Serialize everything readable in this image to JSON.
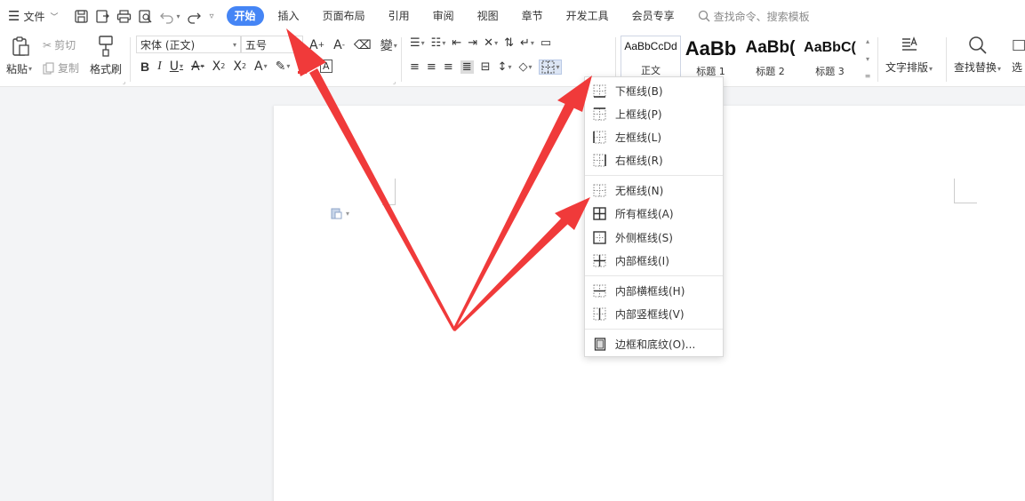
{
  "menu": {
    "file_label": "文件",
    "tabs": [
      {
        "label": "开始",
        "active": true
      },
      {
        "label": "插入"
      },
      {
        "label": "页面布局"
      },
      {
        "label": "引用"
      },
      {
        "label": "审阅"
      },
      {
        "label": "视图"
      },
      {
        "label": "章节"
      },
      {
        "label": "开发工具"
      },
      {
        "label": "会员专享"
      }
    ],
    "search_placeholder": "查找命令、搜索模板"
  },
  "ribbon": {
    "paste_label": "粘贴",
    "cut_label": "剪切",
    "copy_label": "复制",
    "format_painter_label": "格式刷",
    "font_name": "宋体 (正文)",
    "font_size": "五号",
    "styles": [
      {
        "sample": "AaBbCcDd",
        "label": "正文"
      },
      {
        "sample": "AaBb",
        "label": "标题 1"
      },
      {
        "sample": "AaBb(",
        "label": "标题 2"
      },
      {
        "sample": "AaBbC(",
        "label": "标题 3"
      }
    ],
    "text_layout_label": "文字排版",
    "find_replace_label": "查找替换",
    "select_label": "选"
  },
  "border_menu": {
    "items": [
      {
        "label": "下框线(B)",
        "icon": "bottom-border-icon"
      },
      {
        "label": "上框线(P)",
        "icon": "top-border-icon"
      },
      {
        "label": "左框线(L)",
        "icon": "left-border-icon"
      },
      {
        "label": "右框线(R)",
        "icon": "right-border-icon"
      },
      {
        "label": "无框线(N)",
        "icon": "no-border-icon"
      },
      {
        "label": "所有框线(A)",
        "icon": "all-borders-icon"
      },
      {
        "label": "外侧框线(S)",
        "icon": "outside-borders-icon"
      },
      {
        "label": "内部框线(I)",
        "icon": "inside-borders-icon"
      },
      {
        "label": "内部横框线(H)",
        "icon": "inside-horizontal-border-icon"
      },
      {
        "label": "内部竖框线(V)",
        "icon": "inside-vertical-border-icon"
      },
      {
        "label": "边框和底纹(O)...",
        "icon": "borders-and-shading-icon"
      }
    ]
  },
  "colors": {
    "accent": "#4585f5",
    "annotation_arrow": "#f03a3a"
  }
}
